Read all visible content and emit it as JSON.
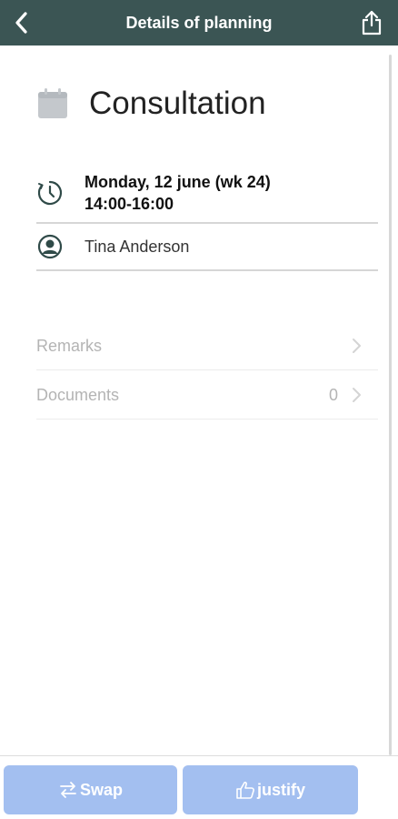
{
  "header": {
    "title": "Details of planning",
    "back_icon": "chevron-left-icon",
    "share_icon": "share-icon"
  },
  "appointment": {
    "title": "Consultation",
    "icon": "calendar-icon",
    "date": "Monday, 12 june (wk 24)",
    "time": "14:00-16:00",
    "time_icon": "clock-icon",
    "person": "Tina Anderson",
    "person_icon": "person-icon"
  },
  "links": {
    "remarks_label": "Remarks",
    "documents_label": "Documents",
    "documents_count": "0"
  },
  "footer": {
    "swap_label": "Swap",
    "swap_icon": "swap-arrows-icon",
    "justify_label": "justify",
    "justify_icon": "thumbs-up-icon"
  },
  "colors": {
    "header_bg": "#3b5554",
    "button_bg": "#a3bff0",
    "icon_gray": "#c4c8cc",
    "icon_dark": "#2f4a48"
  }
}
